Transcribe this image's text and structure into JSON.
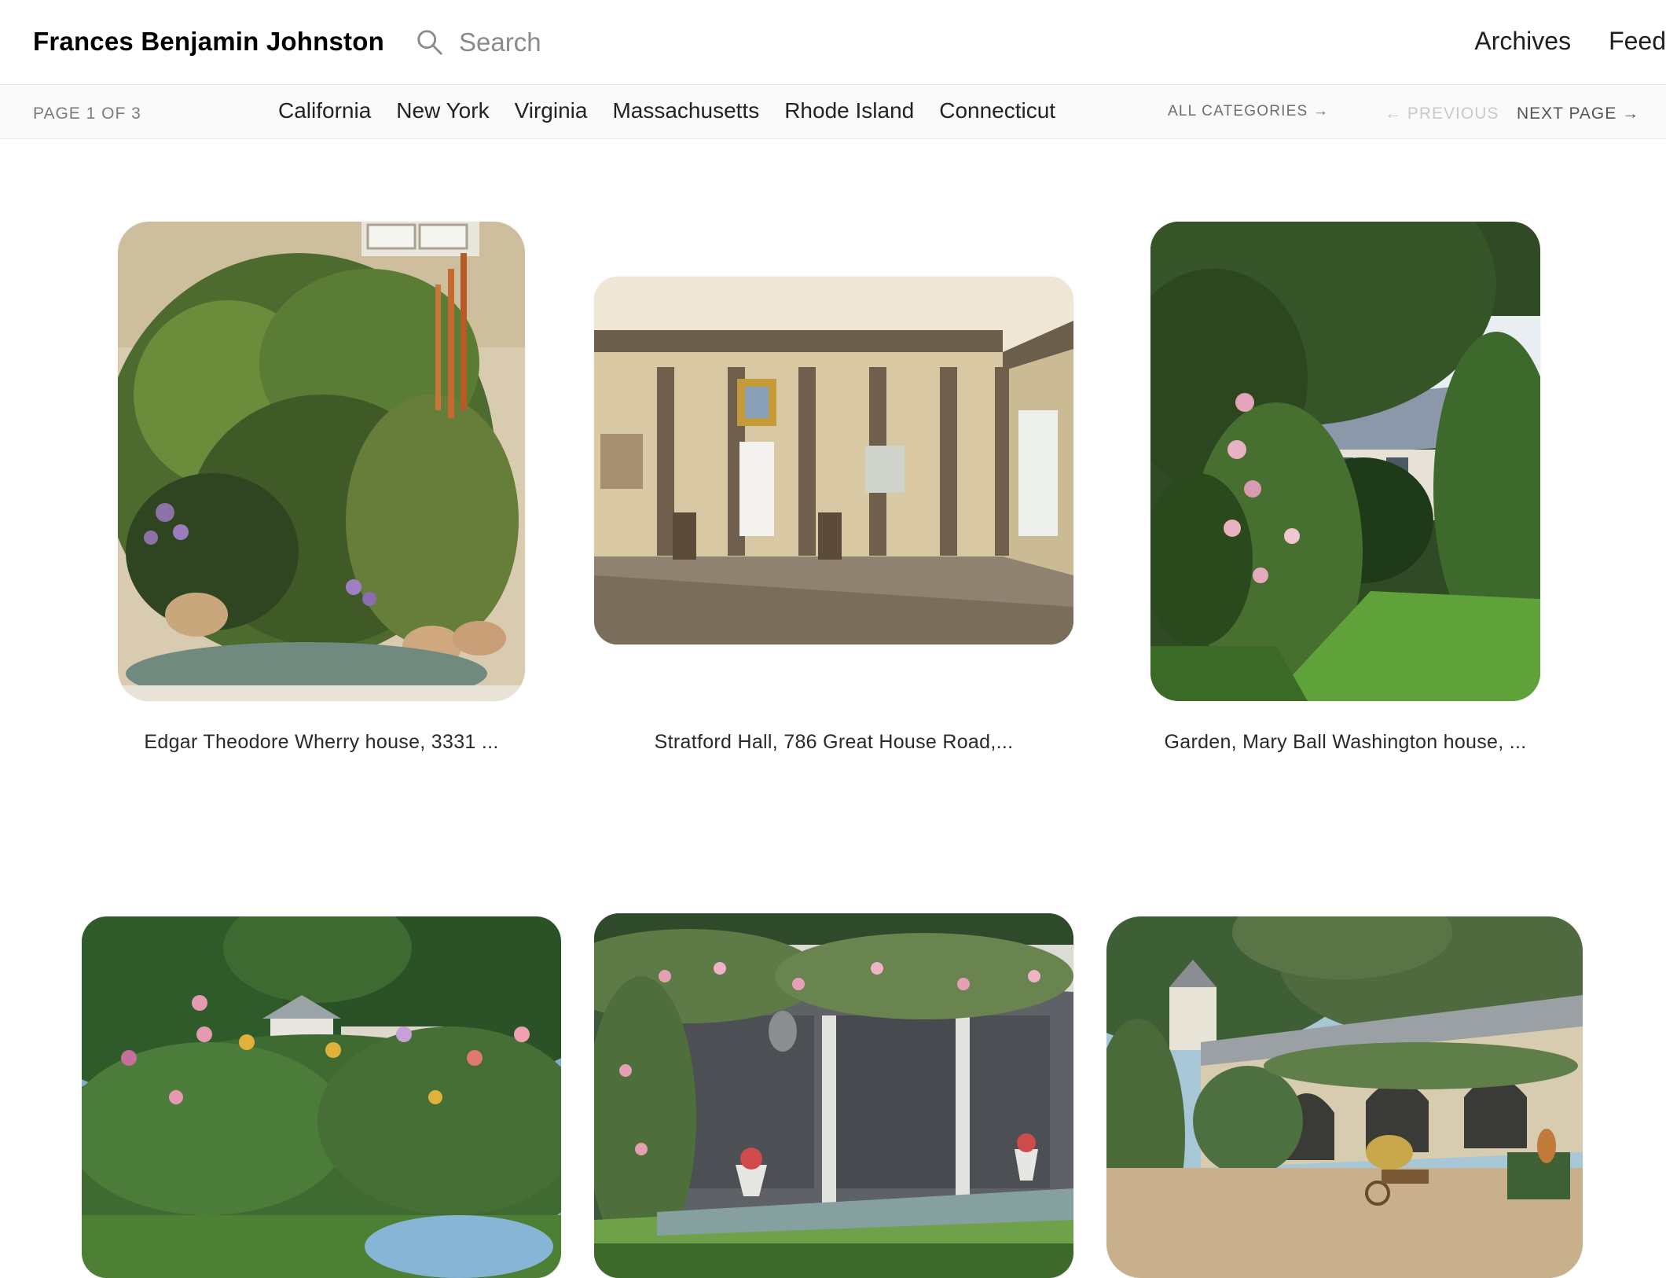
{
  "header": {
    "site_title": "Frances Benjamin Johnston",
    "search_placeholder": "Search",
    "nav": [
      {
        "label": "Archives"
      },
      {
        "label": "Feed"
      }
    ]
  },
  "subbar": {
    "page_indicator": "PAGE 1 OF 3",
    "categories": [
      {
        "label": "California"
      },
      {
        "label": "New York"
      },
      {
        "label": "Virginia"
      },
      {
        "label": "Massachusetts"
      },
      {
        "label": "Rhode Island"
      },
      {
        "label": "Connecticut"
      }
    ],
    "all_categories": "ALL CATEGORIES →",
    "previous": "← PREVIOUS",
    "next": "NEXT PAGE →"
  },
  "gallery": {
    "items": [
      {
        "caption": "Edgar Theodore Wherry house, 3331 ...",
        "subject": "fern-garden-pond"
      },
      {
        "caption": "Stratford Hall, 786 Great House Road,...",
        "subject": "paneled-interior-room"
      },
      {
        "caption": "Garden, Mary Ball Washington house, ...",
        "subject": "hollyhock-garden-house"
      },
      {
        "caption": "",
        "subject": "flower-border-cottage"
      },
      {
        "caption": "",
        "subject": "rose-covered-loggia"
      },
      {
        "caption": "",
        "subject": "arched-courtyard-dovecote"
      }
    ]
  }
}
